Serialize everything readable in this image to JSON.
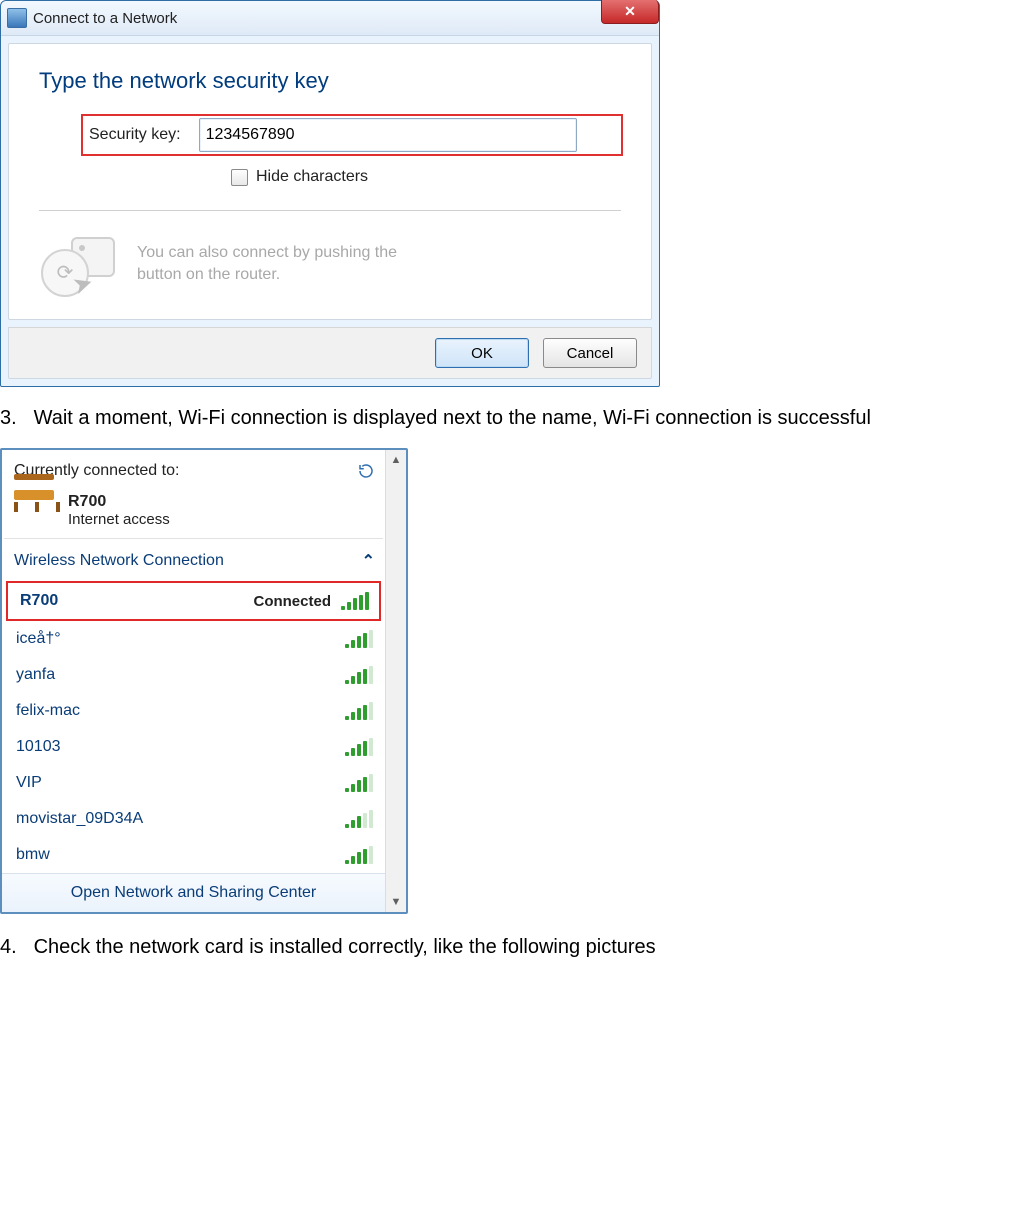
{
  "dialog": {
    "title": "Connect to a Network",
    "close_glyph": "✕",
    "heading": "Type the network security key",
    "key_label": "Security key:",
    "key_value": "1234567890",
    "hide_label": "Hide characters",
    "wps_text1": "You can also connect by pushing the",
    "wps_text2": "button on the router.",
    "ok_label": "OK",
    "cancel_label": "Cancel"
  },
  "step3": {
    "num": "3.",
    "text": "Wait a moment, Wi-Fi connection is displayed next to the name, Wi-Fi connection is successful"
  },
  "netpopup": {
    "currently_label": "Currently connected to:",
    "connected_name": "R700",
    "connected_sub": "Internet access",
    "section_label": "Wireless Network Connection",
    "networks": [
      {
        "name": "R700",
        "status": "Connected",
        "strength": 5,
        "current": true
      },
      {
        "name": "iceå†°",
        "status": "",
        "strength": 4,
        "current": false
      },
      {
        "name": "yanfa",
        "status": "",
        "strength": 4,
        "current": false
      },
      {
        "name": "felix-mac",
        "status": "",
        "strength": 4,
        "current": false
      },
      {
        "name": "10103",
        "status": "",
        "strength": 4,
        "current": false
      },
      {
        "name": "VIP",
        "status": "",
        "strength": 4,
        "current": false
      },
      {
        "name": "movistar_09D34A",
        "status": "",
        "strength": 3,
        "current": false
      },
      {
        "name": "bmw",
        "status": "",
        "strength": 4,
        "current": false
      }
    ],
    "footer_link": "Open Network and Sharing Center"
  },
  "step4": {
    "num": "4.",
    "text": "Check the network card is installed correctly, like the following pictures"
  }
}
